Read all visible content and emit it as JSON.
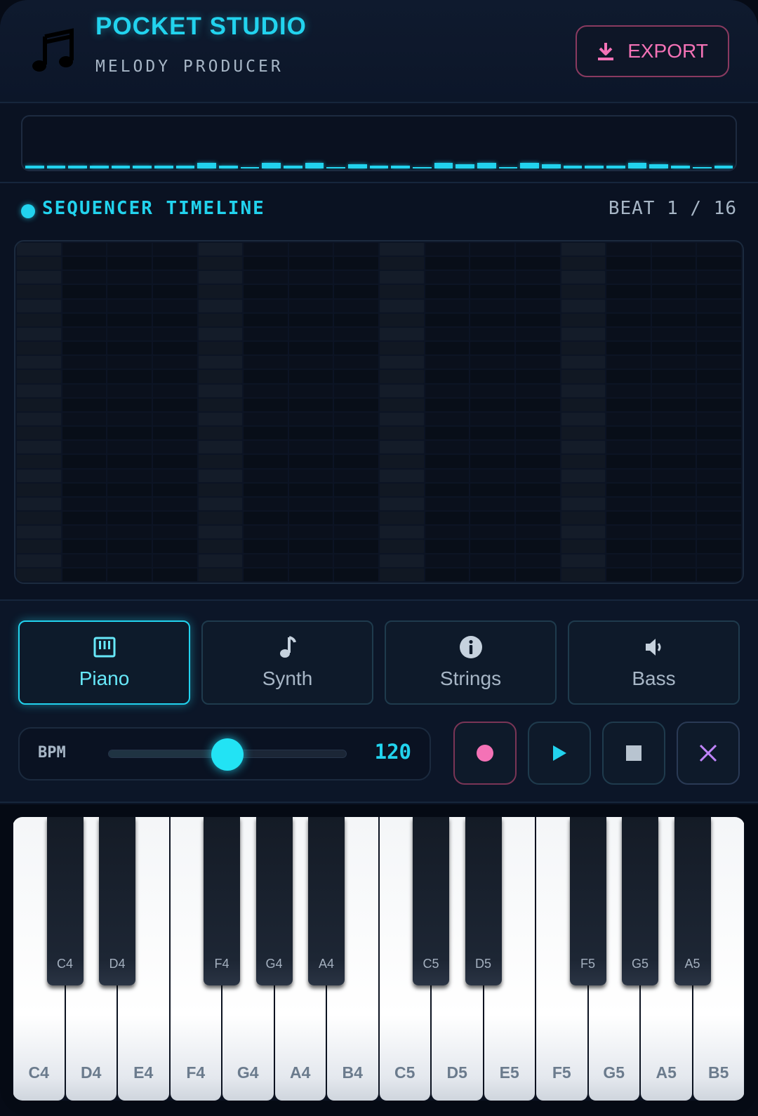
{
  "header": {
    "title": "POCKET STUDIO",
    "subtitle": "MELODY PRODUCER",
    "export_label": "EXPORT",
    "logo_icon": "music-note-icon",
    "accent": "#22d3ee",
    "export_color": "#f472b6"
  },
  "waveform": {
    "levels": [
      0.2,
      0.2,
      0.2,
      0.2,
      0.2,
      0.2,
      0.2,
      0.2,
      0.4,
      0.2,
      0.1,
      0.4,
      0.2,
      0.4,
      0.1,
      0.3,
      0.2,
      0.2,
      0.1,
      0.4,
      0.3,
      0.4,
      0.1,
      0.4,
      0.3,
      0.2,
      0.2,
      0.2,
      0.4,
      0.3,
      0.2,
      0.1,
      0.2
    ]
  },
  "sequencer": {
    "title": "SEQUENCER TIMELINE",
    "beat_label": "BEAT 1 / 16",
    "steps": 16,
    "rows": 24,
    "current_beat": 1
  },
  "instruments": [
    {
      "label": "Piano",
      "icon": "piano-icon",
      "active": true
    },
    {
      "label": "Synth",
      "icon": "note-icon",
      "active": false
    },
    {
      "label": "Strings",
      "icon": "info-icon",
      "active": false
    },
    {
      "label": "Bass",
      "icon": "speaker-icon",
      "active": false
    }
  ],
  "bpm": {
    "label": "BPM",
    "value": "120",
    "slider_fraction": 0.5
  },
  "transport": {
    "record_icon": "record-icon",
    "play_icon": "play-icon",
    "stop_icon": "stop-icon",
    "clear_icon": "close-icon",
    "record_color": "#f472b6",
    "play_color": "#22d3ee",
    "stop_color": "#b8c4d0",
    "clear_color": "#c084fc"
  },
  "piano": {
    "white_keys": [
      "C4",
      "D4",
      "E4",
      "F4",
      "G4",
      "A4",
      "B4",
      "C5",
      "D5",
      "E5",
      "F5",
      "G5",
      "A5",
      "B5"
    ],
    "black_keys": [
      {
        "label": "C4",
        "after": 0
      },
      {
        "label": "D4",
        "after": 1
      },
      {
        "label": "F4",
        "after": 3
      },
      {
        "label": "G4",
        "after": 4
      },
      {
        "label": "A4",
        "after": 5
      },
      {
        "label": "C5",
        "after": 7
      },
      {
        "label": "D5",
        "after": 8
      },
      {
        "label": "F5",
        "after": 10
      },
      {
        "label": "G5",
        "after": 11
      },
      {
        "label": "A5",
        "after": 12
      }
    ]
  }
}
